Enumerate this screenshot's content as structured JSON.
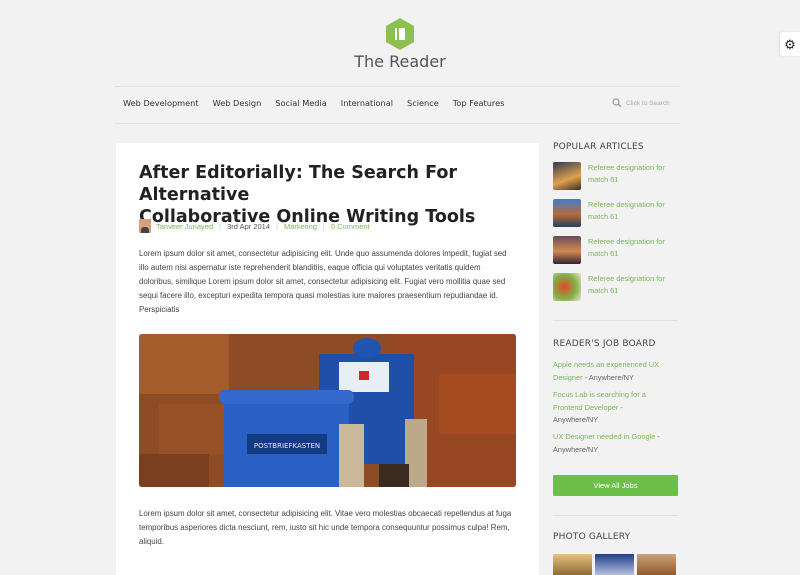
{
  "site": {
    "title": "The Reader"
  },
  "nav": {
    "items": [
      "Web Development",
      "Web Design",
      "Social Media",
      "International",
      "Science",
      "Top Features"
    ],
    "search_placeholder": "Click to Search"
  },
  "article": {
    "title_line1": "After Editorially: The Search For Alternative",
    "title_line2": "Collaborative Online Writing Tools",
    "author": "Tanveer Junayed",
    "date": "3rd Apr 2014",
    "category": "Marketing",
    "comments": "0 Comment",
    "para1": "Lorem ipsum dolor sit amet, consectetur adipisicing elit. Unde quo assumenda dolores impedit, fugiat sed illo autem nisi aspernatur iste reprehenderit blanditiis, eaque officia qui voluptates veritatis quidem doloribus, similique Lorem ipsum dolor sit amet, consectetur adipisicing elit. Fugiat vero mollitia quae sed sequi facere illo, excepturi expedita tempora quasi molestias iure maiores praesentium repudiandae id. Perspiciatis",
    "image_text": "POSTBRIEFKASTEN",
    "para2": "Lorem ipsum dolor sit amet, consectetur adipisicing elit. Vitae vero molestias obcaecati repellendus at fuga temporibus asperiores dicta nesciunt, rem, iusto sit hic unde tempora consequuntur possimus culpa! Rem, aliquid."
  },
  "sidebar": {
    "popular_heading": "POPULAR ARTICLES",
    "popular": [
      {
        "line1": "Referee designation for",
        "line2": "match 61"
      },
      {
        "line1": "Referee designation for",
        "line2": "match 61"
      },
      {
        "line1": "Referee designation for",
        "line2": "match 61"
      },
      {
        "line1": "Referee designation for",
        "line2": "match 61"
      }
    ],
    "jobs_heading": "READER'S JOB BOARD",
    "jobs": [
      {
        "title_a": "Apple needs an experienced UX",
        "title_b": "Designer",
        "loc": " - Anywhere/NY"
      },
      {
        "title_a": "Focus Lab is searching for a",
        "title_b": "Frontend Developer",
        "loc": " -",
        "loc2": "Anywhere/NY"
      },
      {
        "title_a": "UX Designer needed in Google",
        "loc": " -",
        "loc2": "Anywhere/NY"
      }
    ],
    "view_all": "View All Jobs",
    "gallery_heading": "PHOTO GALLERY"
  },
  "colors": {
    "accent": "#7ab55c",
    "button": "#6cc04a",
    "logo": "#8cc152"
  }
}
